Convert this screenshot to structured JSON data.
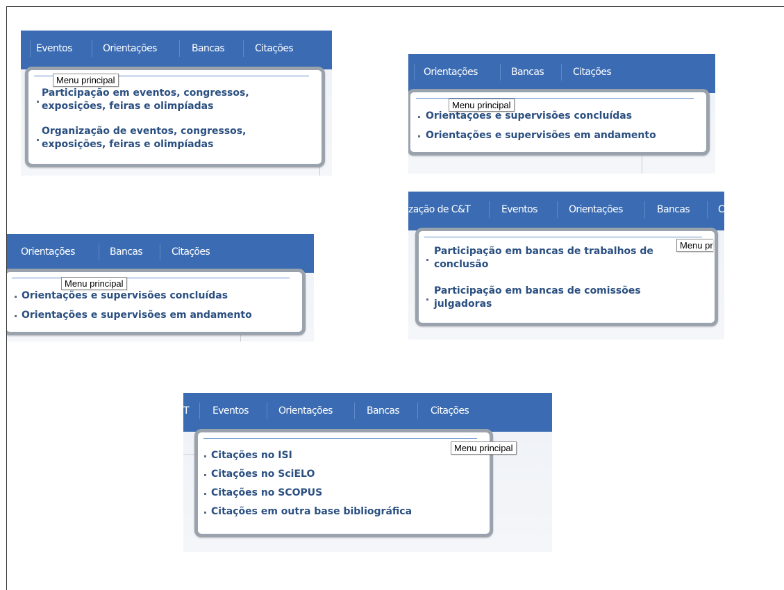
{
  "tooltip": "Menu principal",
  "tooltip_cut": "Menu pr",
  "nav": {
    "eventos": "Eventos",
    "orientacoes": "Orientações",
    "bancas": "Bancas",
    "citacoes": "Citações",
    "producao_ct": "zação de C&T",
    "cut_t": "T",
    "cut_c": "C"
  },
  "menus": {
    "eventos": [
      [
        "Participação em eventos, congressos,",
        "exposições, feiras e olimpíadas"
      ],
      [
        "Organização de eventos, congressos,",
        "exposições, feiras e olimpíadas"
      ]
    ],
    "orientacoes": [
      "Orientações e supervisões concluídas",
      "Orientações e supervisões em andamento"
    ],
    "bancas": [
      [
        "Participação em bancas de trabalhos de",
        "conclusão"
      ],
      [
        "Participação em bancas de comissões",
        "julgadoras"
      ]
    ],
    "citacoes": [
      "Citações no ISI",
      "Citações no SciELO",
      "Citações no SCOPUS",
      "Citações em outra base bibliográfica"
    ]
  },
  "colors": {
    "nav_bg": "#3b6cb3",
    "link": "#2a4f80",
    "menu_border": "#9aa3ad"
  }
}
